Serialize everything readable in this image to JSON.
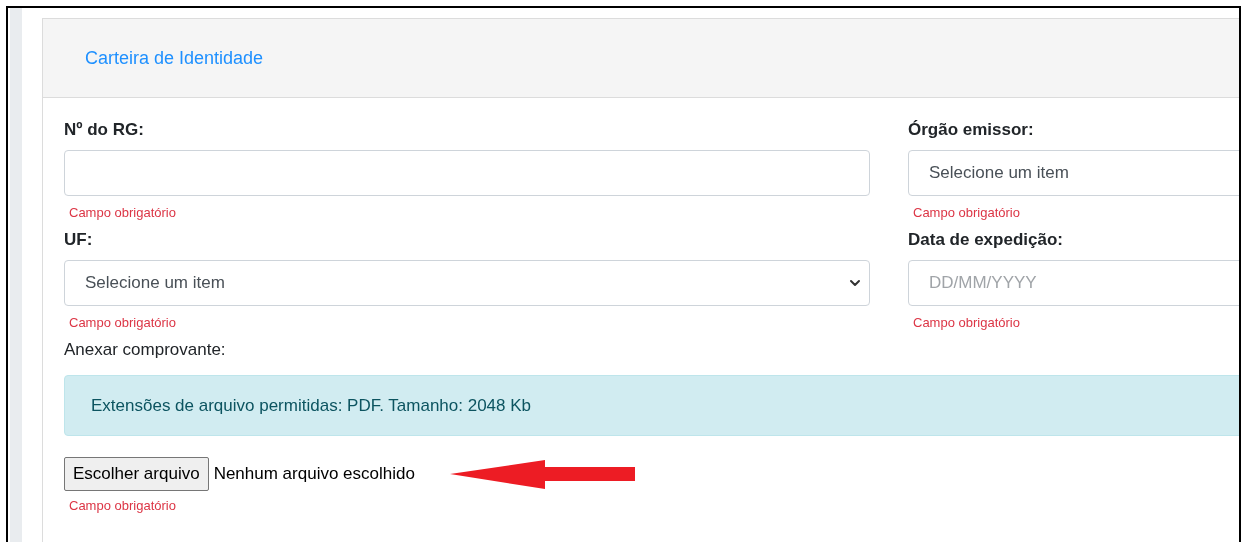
{
  "card": {
    "title": "Carteira de Identidade"
  },
  "fields": [
    {
      "label": "Nº do RG:",
      "kind": "input",
      "error": "Campo obrigatório"
    },
    {
      "label": "Órgão emissor:",
      "kind": "select",
      "value": "Selecione um item",
      "error": "Campo obrigatório"
    },
    {
      "label": "UF:",
      "kind": "select",
      "value": "Selecione um item",
      "error": "Campo obrigatório"
    },
    {
      "label": "Data de expedição:",
      "kind": "input",
      "placeholder": "DD/MM/YYYY",
      "error": "Campo obrigatório"
    }
  ],
  "attachment": {
    "label": "Anexar comprovante:",
    "info": "Extensões de arquivo permitidas: PDF. Tamanho: 2048 Kb",
    "button": "Escolher arquivo",
    "file_status": "Nenhum arquivo escolhido",
    "error": "Campo obrigatório"
  }
}
